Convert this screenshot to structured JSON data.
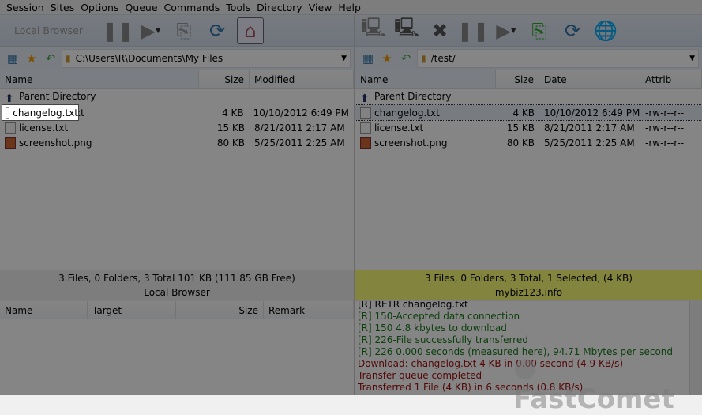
{
  "menu": [
    "Session",
    "Sites",
    "Options",
    "Queue",
    "Commands",
    "Tools",
    "Directory",
    "View",
    "Help"
  ],
  "local": {
    "toolbar_label": "Local Browser",
    "path": "C:\\Users\\R\\Documents\\My Files",
    "columns": [
      "Name",
      "Size",
      "Modified"
    ],
    "files": [
      {
        "name": "Parent Directory",
        "size": "",
        "date": "",
        "icon": "up-arrow-icon"
      },
      {
        "name": "changelog.txt",
        "size": "4 KB",
        "date": "10/10/2012 6:49 PM",
        "icon": "text-file-icon"
      },
      {
        "name": "license.txt",
        "size": "15 KB",
        "date": "8/21/2011 2:17 AM",
        "icon": "text-file-icon"
      },
      {
        "name": "screenshot.png",
        "size": "80 KB",
        "date": "5/25/2011 2:25 AM",
        "icon": "image-file-icon"
      }
    ],
    "status": "3 Files, 0 Folders, 3 Total 101 KB (111.85 GB Free)",
    "title": "Local Browser"
  },
  "remote": {
    "path": "/test/",
    "columns": [
      "Name",
      "Size",
      "Date",
      "Attrib"
    ],
    "files": [
      {
        "name": "Parent Directory",
        "size": "",
        "date": "",
        "attrib": "",
        "icon": "up-arrow-icon"
      },
      {
        "name": "changelog.txt",
        "size": "4 KB",
        "date": "10/10/2012 6:49 PM",
        "attrib": "-rw-r--r--",
        "icon": "text-file-icon",
        "selected": true
      },
      {
        "name": "license.txt",
        "size": "15 KB",
        "date": "8/21/2011 2:17 AM",
        "attrib": "-rw-r--r--",
        "icon": "text-file-icon"
      },
      {
        "name": "screenshot.png",
        "size": "80 KB",
        "date": "5/25/2011 2:25 AM",
        "attrib": "-rw-r--r--",
        "icon": "image-file-icon"
      }
    ],
    "status": "3 Files, 0 Folders, 3 Total, 1 Selected, (4 KB)",
    "title": "mybiz123.info",
    "status_color": "#fbff78"
  },
  "queue": {
    "columns": [
      "Name",
      "Target",
      "Size",
      "Remark"
    ]
  },
  "log": [
    {
      "text": "[R] RETR changelog.txt",
      "type": "normal"
    },
    {
      "text": "[R] 150-Accepted data connection",
      "type": "g"
    },
    {
      "text": "[R] 150 4.8 kbytes to download",
      "type": "g"
    },
    {
      "text": "[R] 226-File successfully transferred",
      "type": "g"
    },
    {
      "text": "[R] 226 0.000 seconds (measured here), 94.71 Mbytes per second",
      "type": "g"
    },
    {
      "text": "Download: changelog.txt 4 KB in 0.00 second (4.9 KB/s)",
      "type": "r"
    },
    {
      "text": "Transfer queue completed",
      "type": "r"
    },
    {
      "text": "Transferred 1 File (4 KB) in 6 seconds (0.8 KB/s)",
      "type": "r"
    }
  ],
  "highlight": "changelog.txt",
  "watermark": "FastComet"
}
